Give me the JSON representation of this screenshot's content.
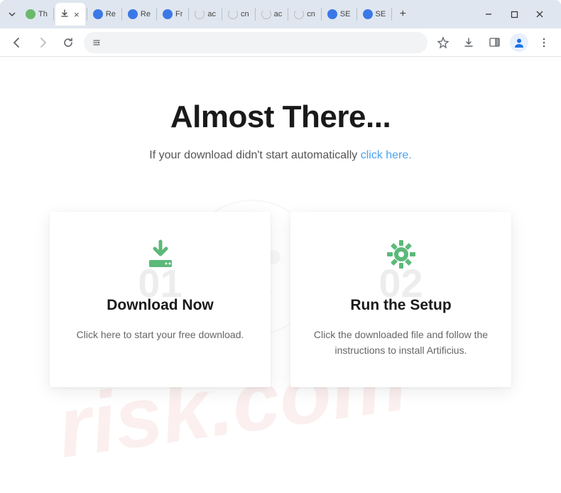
{
  "tabs": [
    {
      "label": "Th",
      "favicon": "green",
      "active": false
    },
    {
      "label": "",
      "favicon": "download",
      "active": true
    },
    {
      "label": "Re",
      "favicon": "blue",
      "active": false
    },
    {
      "label": "Re",
      "favicon": "blue",
      "active": false
    },
    {
      "label": "Fr",
      "favicon": "blue",
      "active": false
    },
    {
      "label": "ac",
      "favicon": "load",
      "active": false
    },
    {
      "label": "cn",
      "favicon": "load",
      "active": false
    },
    {
      "label": "ac",
      "favicon": "load",
      "active": false
    },
    {
      "label": "cn",
      "favicon": "load",
      "active": false
    },
    {
      "label": "SE",
      "favicon": "blue",
      "active": false
    },
    {
      "label": "SE",
      "favicon": "blue",
      "active": false
    }
  ],
  "page": {
    "title": "Almost There...",
    "subtitle_prefix": "If your download didn't start automatically ",
    "subtitle_link": "click here."
  },
  "cards": [
    {
      "num": "01",
      "icon": "download",
      "title": "Download Now",
      "desc": "Click here to start your free download."
    },
    {
      "num": "02",
      "icon": "gear",
      "title": "Run the Setup",
      "desc": "Click the downloaded file and follow the instructions to install Artificius."
    }
  ],
  "watermark": {
    "text": "risk.com"
  }
}
